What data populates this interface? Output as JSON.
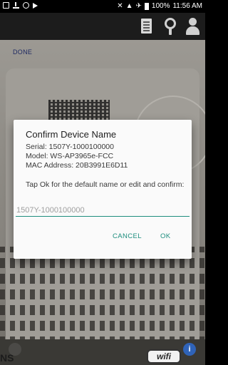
{
  "status_bar": {
    "left_icons": [
      "image-icon",
      "download-icon",
      "sync-icon",
      "play-icon"
    ],
    "mute_glyph": "✕",
    "signal_glyph": "▲",
    "airplane_glyph": "✈",
    "battery_text": "100%",
    "time": "11:56 AM"
  },
  "toolbar": {
    "icons": [
      "document-icon",
      "search-icon",
      "person-icon"
    ]
  },
  "background": {
    "done_label": "DONE",
    "brand_text": "NS",
    "info_glyph": "i",
    "logo_text": "wifi"
  },
  "dialog": {
    "title": "Confirm Device Name",
    "serial": "Serial: 1507Y-1000100000",
    "model": "Model: WS-AP3965e-FCC",
    "mac": "MAC Address: 20B3991E6D11",
    "message": "Tap Ok for the default name or edit and confirm:",
    "input_placeholder": "1507Y-1000100000",
    "input_value": "",
    "cancel_label": "CANCEL",
    "ok_label": "OK"
  },
  "colors": {
    "accent": "#1e8e7e",
    "status_bar": "#000000",
    "toolbar": "#1c1c1c",
    "done_link": "#1f2a63"
  }
}
